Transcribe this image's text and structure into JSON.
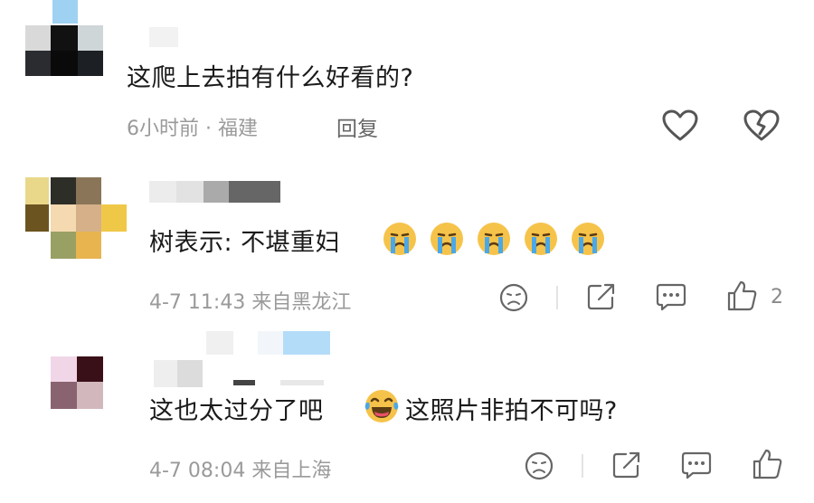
{
  "comments": [
    {
      "text": "这爬上去拍有什么好看的?",
      "meta": "6小时前 · 福建",
      "reply_label": "回复"
    },
    {
      "text": "树表示: 不堪重妇",
      "meta": "4-7 11:43 来自黑龙江",
      "like_count": "2",
      "emoji": "crying-emoji"
    },
    {
      "text_part1": "这也太过分了吧",
      "text_part2": "这照片非拍不可吗?",
      "meta": "4-7 08:04 来自上海",
      "emoji": "laughing-tears-emoji"
    }
  ],
  "colors": {
    "text": "#1a1a1a",
    "meta": "#9a9a9a",
    "icon": "#555555",
    "emoji_face": "#f6c34a",
    "emoji_tear": "#4aa8e8"
  }
}
